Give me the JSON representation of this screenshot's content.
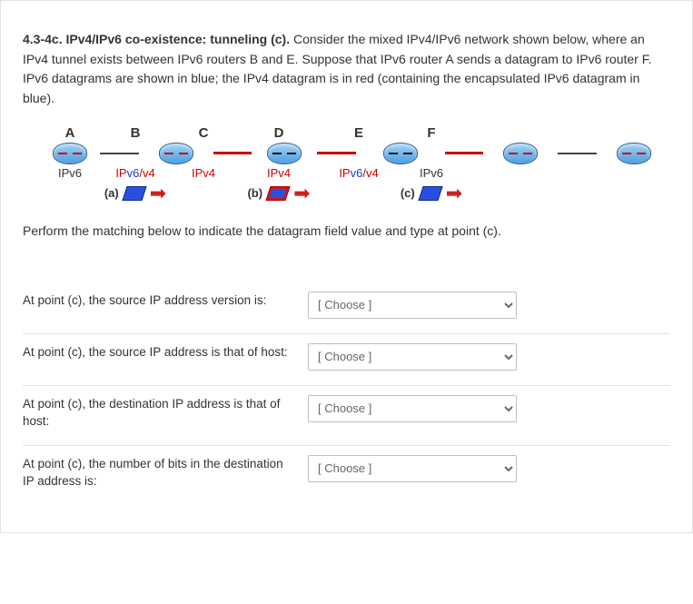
{
  "intro": {
    "title": "4.3-4c. IPv4/IPv6 co-existence: tunneling (c).",
    "body": "  Consider the mixed IPv4/IPv6 network shown below, where an IPv4 tunnel exists between IPv6 routers B and E. Suppose that IPv6 router A sends a datagram to IPv6 router F.  IPv6 datagrams are shown in blue; the IPv4 datagram is in red (containing the encapsulated IPv6 datagram in blue)."
  },
  "diagram": {
    "nodes": {
      "A": "A",
      "B": "B",
      "C": "C",
      "D": "D",
      "E": "E",
      "F": "F"
    },
    "sub": {
      "A": "IPv6",
      "B_pre": "IP",
      "B_span": "v6",
      "B_post": "/v4",
      "C": "IPv4",
      "D": "IPv4",
      "E_pre": "IP",
      "E_span": "v6",
      "E_post": "/v4",
      "F": "IPv6"
    },
    "tags": {
      "a": "(a)",
      "b": "(b)",
      "c": "(c)"
    }
  },
  "prompt": "Perform the matching below to indicate the datagram field value and type at point (c).",
  "questions": {
    "q1": "At point (c), the source IP address version is:",
    "q2": "At point (c), the source IP address is that of host:",
    "q3": "At point (c), the destination IP address is that of host:",
    "q4": "At point (c), the number of bits in the destination IP address is:"
  },
  "select_placeholder": "[ Choose ]"
}
